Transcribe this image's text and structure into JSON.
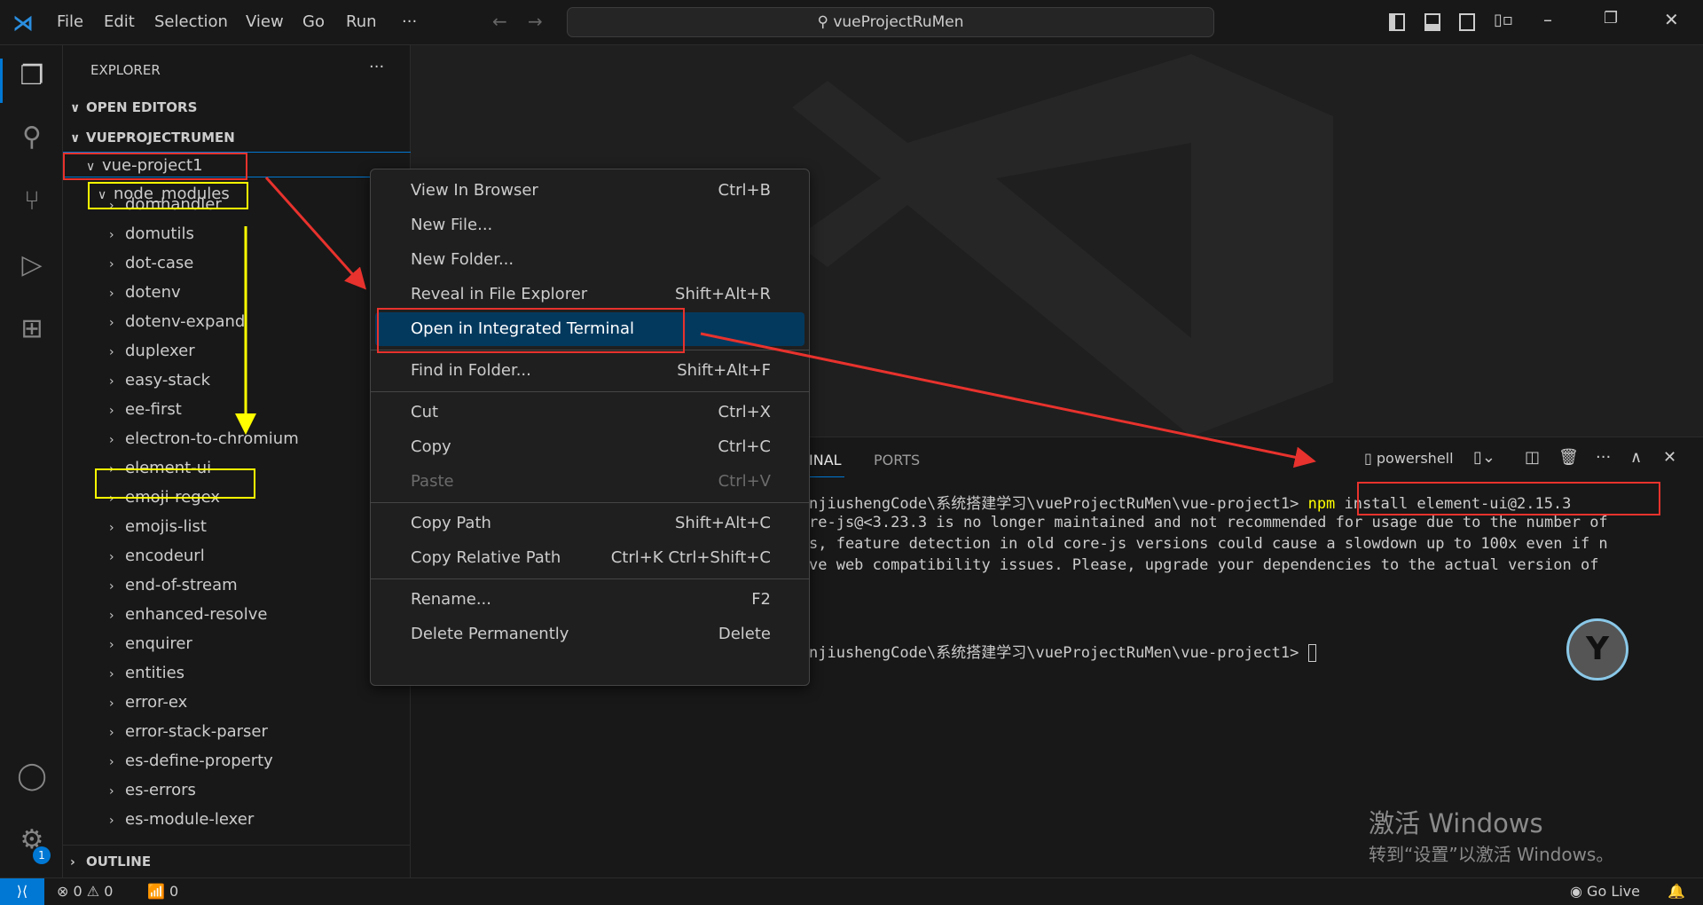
{
  "titlebar": {
    "menus": [
      "File",
      "Edit",
      "Selection",
      "View",
      "Go",
      "Run",
      "···"
    ],
    "search": "vueProjectRuMen",
    "nav_back": "←",
    "nav_fwd": "→",
    "window_controls": [
      "minimize",
      "restore",
      "close"
    ]
  },
  "activity_bar": {
    "items": [
      "explorer-icon",
      "search-icon",
      "source-control-icon",
      "run-debug-icon",
      "extensions-icon"
    ],
    "bottom": [
      "account-icon",
      "settings-icon"
    ],
    "settings_badge": "1"
  },
  "sidebar": {
    "title": "EXPLORER",
    "more": "···",
    "open_editors": "OPEN EDITORS",
    "project": "VUEPROJECTRUMEN",
    "outline": "OUTLINE",
    "tree": [
      {
        "label": "vue-project1",
        "depth": 0,
        "open": true
      },
      {
        "label": "node_modules",
        "depth": 1,
        "open": true
      },
      {
        "label": "domhandler",
        "depth": 2
      },
      {
        "label": "domutils",
        "depth": 2
      },
      {
        "label": "dot-case",
        "depth": 2
      },
      {
        "label": "dotenv",
        "depth": 2
      },
      {
        "label": "dotenv-expand",
        "depth": 2
      },
      {
        "label": "duplexer",
        "depth": 2
      },
      {
        "label": "easy-stack",
        "depth": 2
      },
      {
        "label": "ee-first",
        "depth": 2
      },
      {
        "label": "electron-to-chromium",
        "depth": 2
      },
      {
        "label": "element-ui",
        "depth": 2
      },
      {
        "label": "emoji-regex",
        "depth": 2
      },
      {
        "label": "emojis-list",
        "depth": 2
      },
      {
        "label": "encodeurl",
        "depth": 2
      },
      {
        "label": "end-of-stream",
        "depth": 2
      },
      {
        "label": "enhanced-resolve",
        "depth": 2
      },
      {
        "label": "enquirer",
        "depth": 2
      },
      {
        "label": "entities",
        "depth": 2
      },
      {
        "label": "error-ex",
        "depth": 2
      },
      {
        "label": "error-stack-parser",
        "depth": 2
      },
      {
        "label": "es-define-property",
        "depth": 2
      },
      {
        "label": "es-errors",
        "depth": 2
      },
      {
        "label": "es-module-lexer",
        "depth": 2
      }
    ]
  },
  "context_menu": {
    "groups": [
      [
        {
          "label": "View In Browser",
          "key": "Ctrl+B"
        },
        {
          "label": "New File...",
          "key": ""
        },
        {
          "label": "New Folder...",
          "key": ""
        },
        {
          "label": "Reveal in File Explorer",
          "key": "Shift+Alt+R"
        },
        {
          "label": "Open in Integrated Terminal",
          "key": "",
          "highlighted": true
        }
      ],
      [
        {
          "label": "Find in Folder...",
          "key": "Shift+Alt+F"
        }
      ],
      [
        {
          "label": "Cut",
          "key": "Ctrl+X"
        },
        {
          "label": "Copy",
          "key": "Ctrl+C"
        },
        {
          "label": "Paste",
          "key": "Ctrl+V",
          "disabled": true
        }
      ],
      [
        {
          "label": "Copy Path",
          "key": "Shift+Alt+C"
        },
        {
          "label": "Copy Relative Path",
          "key": "Ctrl+K Ctrl+Shift+C"
        }
      ],
      [
        {
          "label": "Rename...",
          "key": "F2"
        },
        {
          "label": "Delete Permanently",
          "key": "Delete"
        }
      ]
    ]
  },
  "panel": {
    "tabs": [
      "INAL",
      "PORTS"
    ],
    "shell": "powershell",
    "lines": [
      {
        "prompt": "njiushengCode\\系统搭建学习\\vueProjectRuMen\\vue-project1> ",
        "cmd_kw": "npm",
        "cmd": " install element-ui@2.15.3"
      },
      {
        "text": "re-js@<3.23.3 is no longer maintained and not recommended for usage due to the number of"
      },
      {
        "text": "s, feature detection in old core-js versions could cause a slowdown up to 100x even if n"
      },
      {
        "text": "ve web compatibility issues. Please, upgrade your dependencies to the actual version of"
      },
      {
        "prompt": "njiushengCode\\系统搭建学习\\vueProjectRuMen\\vue-project1> "
      }
    ]
  },
  "watermark": {
    "line1": "激活 Windows",
    "line2": "转到“设置”以激活 Windows。"
  },
  "status": {
    "errors": "0",
    "warnings": "0",
    "ports": "0",
    "golive": "Go Live"
  },
  "colors": {
    "accent": "#0078d4",
    "highlight": "#04395e",
    "annotation_red": "#e8322d",
    "annotation_yellow": "#ffff00",
    "npm": "#ffff00"
  }
}
